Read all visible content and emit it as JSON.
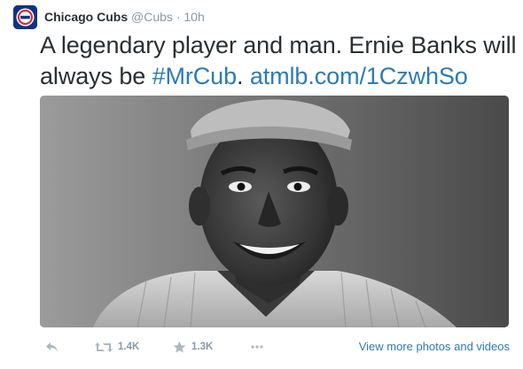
{
  "tweet": {
    "author_name": "Chicago Cubs",
    "author_handle": "@Cubs",
    "separator": "·",
    "time": "10h",
    "avatar_icon": "cubs-logo-icon",
    "text_before": "A legendary player and man. Ernie Banks will always be ",
    "hashtag": "#MrCub",
    "text_mid": ". ",
    "link": "atmlb.com/1CzwhSo",
    "photo": "black-and-white portrait photo",
    "actions": {
      "reply_icon": "reply-icon",
      "retweet_icon": "retweet-icon",
      "retweet_count": "1.4K",
      "favorite_icon": "star-icon",
      "favorite_count": "1.3K",
      "more_icon": "more-dots-icon",
      "more_media_label": "View more photos and videos"
    },
    "colors": {
      "link": "#2b7bb9",
      "muted": "#8899a6",
      "text": "#292f33",
      "brand_blue": "#0e3386",
      "brand_red": "#cc3433"
    }
  }
}
